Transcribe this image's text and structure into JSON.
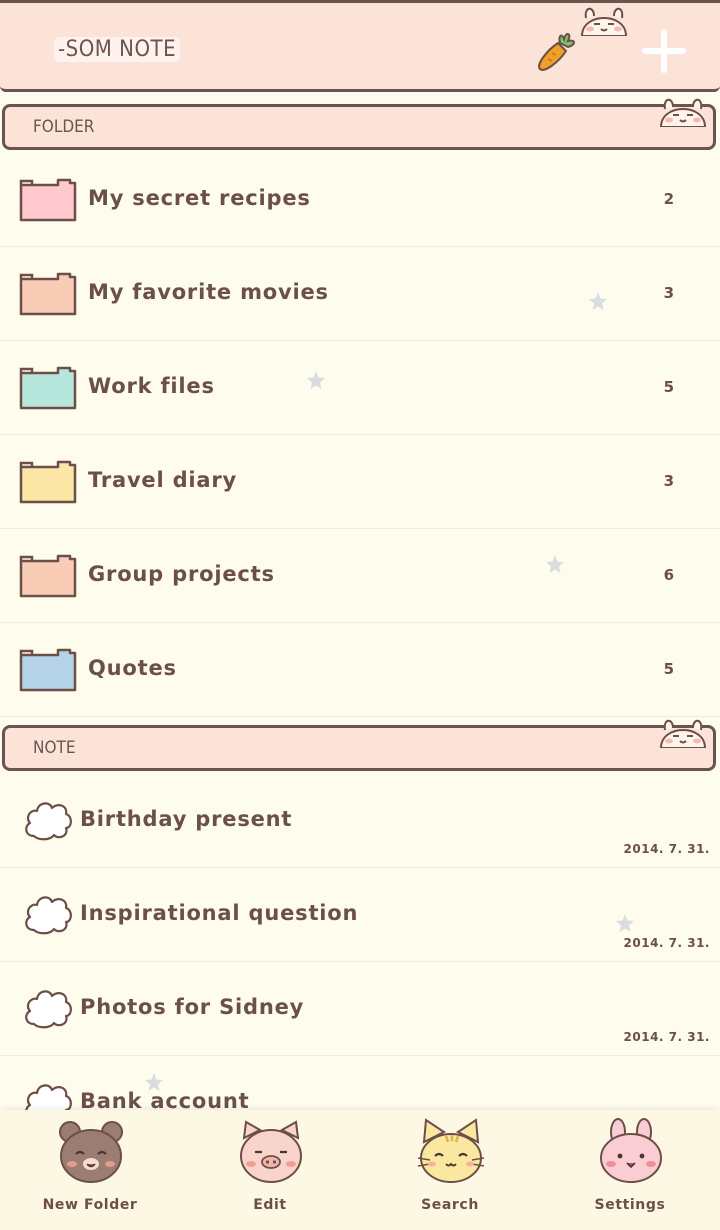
{
  "header": {
    "title": "-SOM NOTE"
  },
  "sections": {
    "folder_label": "FOLDER",
    "note_label": "NOTE"
  },
  "folders": [
    {
      "name": "My secret recipes",
      "count": "2",
      "color": "#ffc9cf"
    },
    {
      "name": "My favorite movies",
      "count": "3",
      "color": "#f9cdb5"
    },
    {
      "name": "Work files",
      "count": "5",
      "color": "#b7e6dc"
    },
    {
      "name": "Travel diary",
      "count": "3",
      "color": "#fbe6a6"
    },
    {
      "name": "Group projects",
      "count": "6",
      "color": "#f9cdb5"
    },
    {
      "name": "Quotes",
      "count": "5",
      "color": "#b5d3e8"
    }
  ],
  "notes": [
    {
      "name": "Birthday present",
      "date": "2014. 7. 31."
    },
    {
      "name": "Inspirational question",
      "date": "2014. 7. 31."
    },
    {
      "name": "Photos for Sidney",
      "date": "2014. 7. 31."
    },
    {
      "name": "Bank account",
      "date": ""
    }
  ],
  "bottom_nav": [
    {
      "label": "New Folder",
      "icon": "bear-icon"
    },
    {
      "label": "Edit",
      "icon": "pig-icon"
    },
    {
      "label": "Search",
      "icon": "cat-icon"
    },
    {
      "label": "Settings",
      "icon": "bunny-icon"
    }
  ],
  "colors": {
    "background": "#fefcec",
    "header_bg": "#fbe3d8",
    "outline": "#6b5450",
    "text": "#6b4f48"
  }
}
